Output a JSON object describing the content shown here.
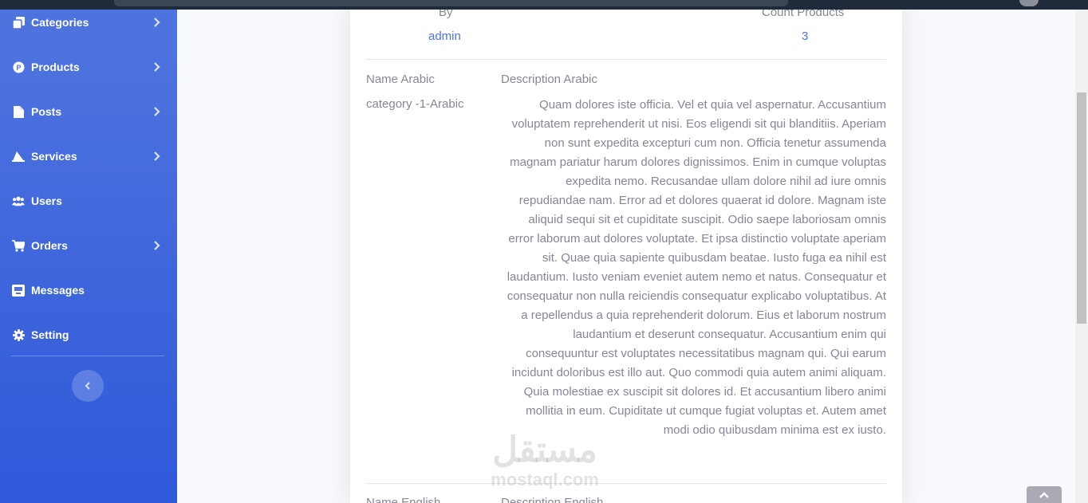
{
  "sidebar": {
    "items": [
      {
        "label": "Categories",
        "icon": "copy-icon",
        "has_submenu": true
      },
      {
        "label": "Products",
        "icon": "product-icon",
        "has_submenu": true
      },
      {
        "label": "Posts",
        "icon": "file-icon",
        "has_submenu": true
      },
      {
        "label": "Services",
        "icon": "services-icon",
        "has_submenu": true
      },
      {
        "label": "Users",
        "icon": "users-icon",
        "has_submenu": false
      },
      {
        "label": "Orders",
        "icon": "cart-icon",
        "has_submenu": true
      },
      {
        "label": "Messages",
        "icon": "inbox-icon",
        "has_submenu": false
      },
      {
        "label": "Setting",
        "icon": "gear-icon",
        "has_submenu": false
      }
    ],
    "toggle_icon": "chevron-left-icon"
  },
  "details": {
    "by_label": "By",
    "by_value": "admin",
    "count_label": "Count Products",
    "count_value": "3",
    "name_ar_label": "Name Arabic",
    "name_ar_value": "category -1-Arabic",
    "desc_ar_label": "Description Arabic",
    "desc_ar_value": "Quam dolores iste officia. Vel et quia vel aspernatur. Accusantium voluptatem reprehenderit ut nisi. Eos eligendi sit qui blanditiis. Aperiam non sunt expedita excepturi cum non. Officia tenetur assumenda magnam pariatur harum dolores dignissimos. Enim in cumque voluptas expedita nemo. Recusandae ullam dolore nihil ad iure omnis repudiandae nam. Error ad et dolores quaerat id dolore. Magnam iste aliquid sequi sit et cupiditate suscipit. Odio saepe laboriosam omnis error laborum aut dolores voluptate. Et ipsa distinctio voluptate aperiam sit. Quae quia sapiente quibusdam beatae. Iusto fuga ea nihil est laudantium. Iusto veniam eveniet autem nemo et natus. Consequatur et consequatur non nulla reiciendis consequatur explicabo voluptatibus. At a repellendus a quia reprehenderit dolorum. Eius et laborum nostrum laudantium et deserunt consequatur. Accusantium enim qui consequuntur est voluptates necessitatibus magnam qui. Qui earum incidunt doloribus est illo aut. Quo commodi quia autem animi aliquam. Quia molestiae ex suscipit sit dolores id. Et accusantium libero animi mollitia in eum. Cupiditate ut cumque fugiat voluptas et. Autem amet modi odio quibusdam minima est ex iusto.",
    "name_en_label": "Name English",
    "desc_en_label": "Description English"
  },
  "watermark": {
    "arabic": "مستقل",
    "latin": "mostaql.com"
  },
  "scroll_top_icon": "chevron-up-icon",
  "colors": {
    "sidebar_top": "#4e73df",
    "sidebar_bottom": "#2e59d9",
    "link": "#4e73df",
    "text_muted": "#858796"
  }
}
